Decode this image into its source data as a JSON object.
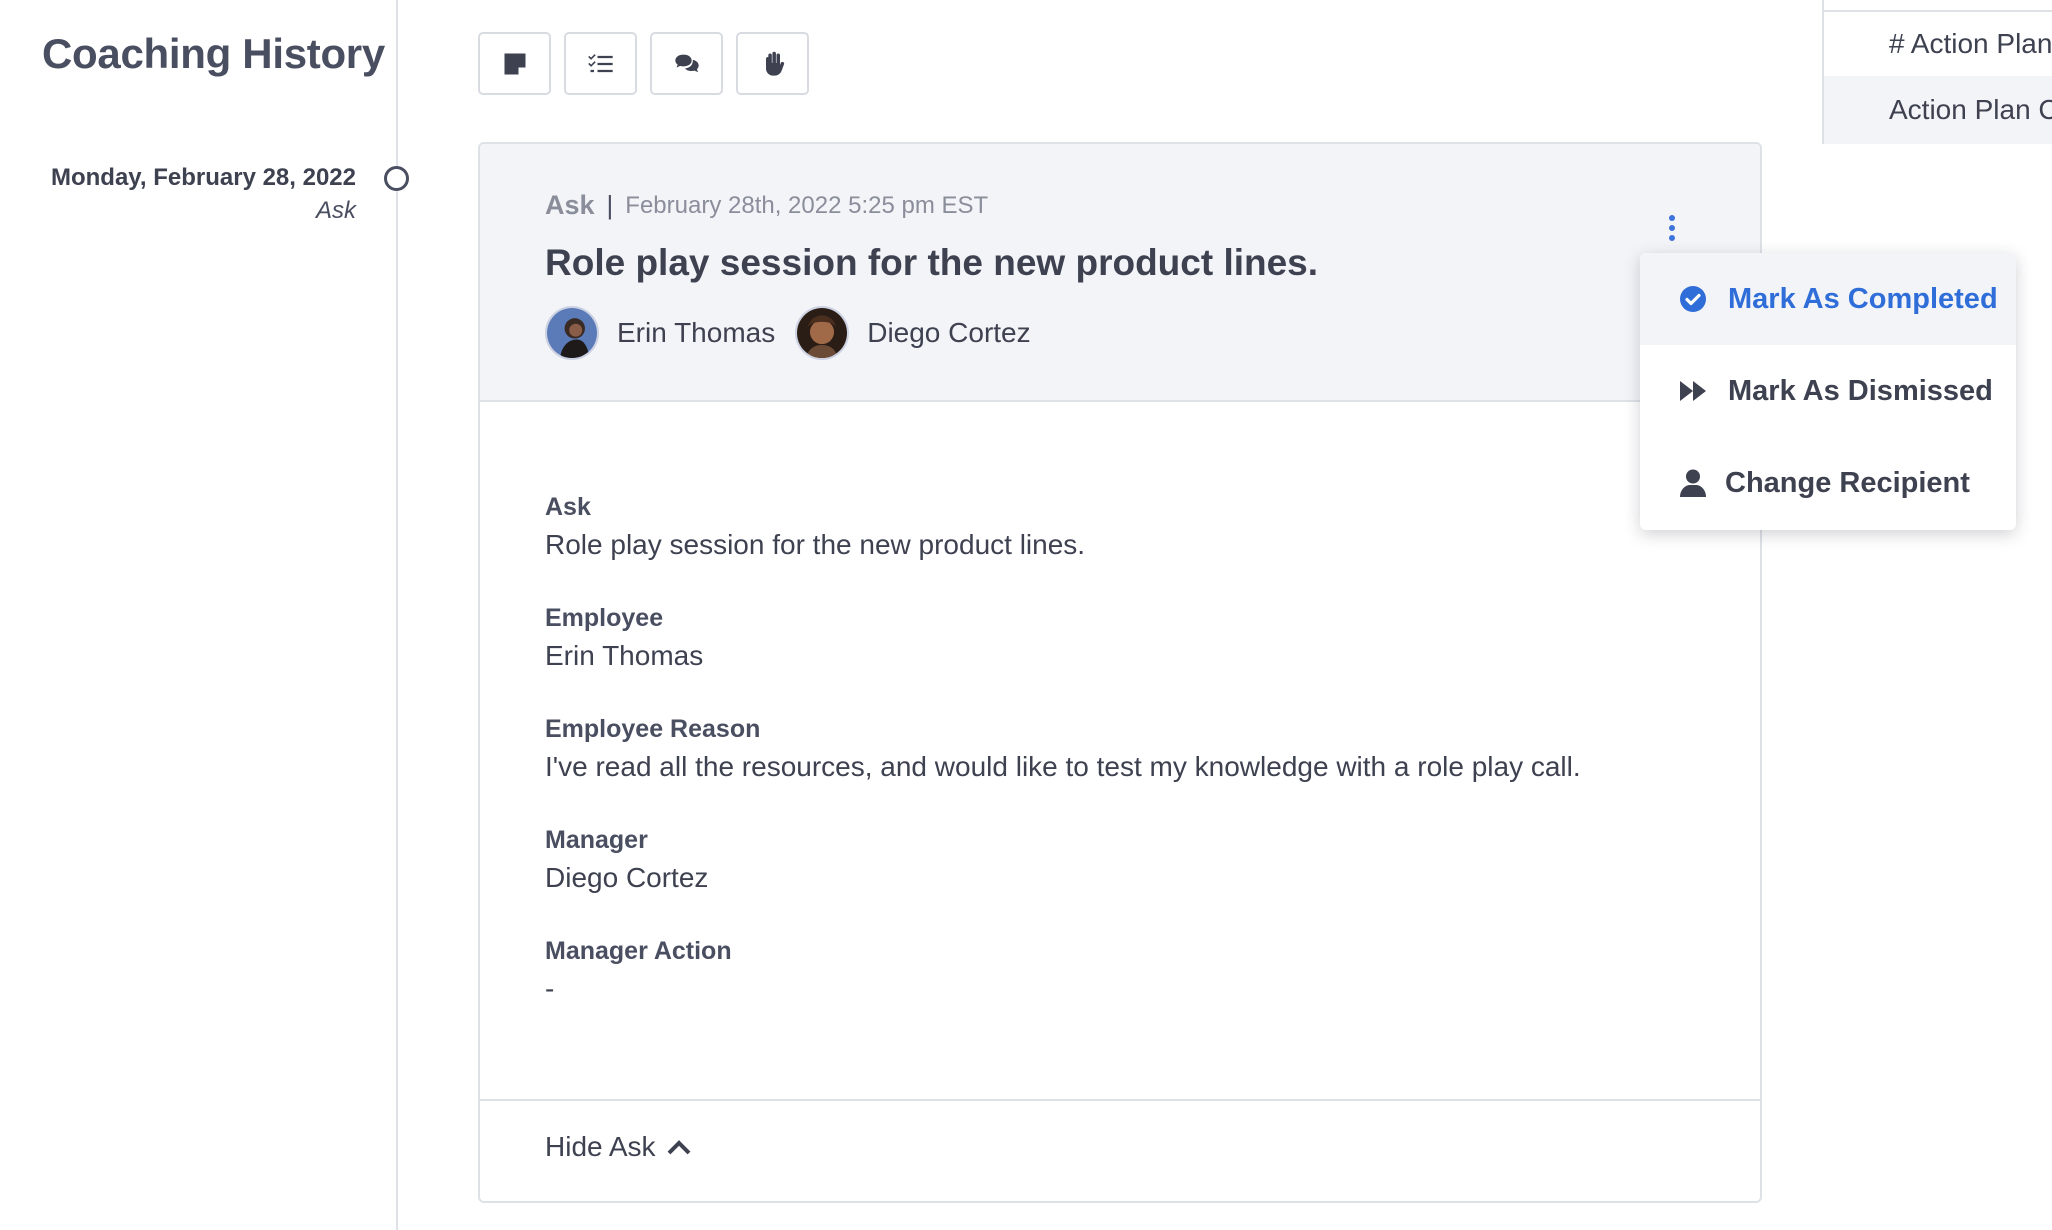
{
  "sidebar": {
    "title": "Coaching History",
    "entry": {
      "date": "Monday, February 28, 2022",
      "type": "Ask"
    }
  },
  "toolbar": {
    "buttons": [
      {
        "icon": "note-icon"
      },
      {
        "icon": "checklist-icon"
      },
      {
        "icon": "comments-icon"
      },
      {
        "icon": "raised-hand-icon"
      }
    ]
  },
  "card": {
    "type": "Ask",
    "separator": "|",
    "timestamp": "February 28th, 2022 5:25 pm EST",
    "title": "Role play session for the new product lines.",
    "people": [
      {
        "name": "Erin Thomas"
      },
      {
        "name": "Diego Cortez"
      }
    ],
    "fields": [
      {
        "label": "Ask",
        "value": "Role play session for the new product lines."
      },
      {
        "label": "Employee",
        "value": "Erin Thomas"
      },
      {
        "label": "Employee Reason",
        "value": "I've read all the resources, and would like to test my knowledge with a role play call."
      },
      {
        "label": "Manager",
        "value": "Diego Cortez"
      },
      {
        "label": "Manager Action",
        "value": "-"
      }
    ],
    "footer": {
      "hide_label": "Hide Ask"
    }
  },
  "menu": {
    "items": [
      {
        "label": "Mark As Completed",
        "icon": "check-circle-icon",
        "color": "#2f6ed8"
      },
      {
        "label": "Mark As Dismissed",
        "icon": "fast-forward-icon"
      },
      {
        "label": "Change Recipient",
        "icon": "user-icon"
      }
    ]
  },
  "right_panel": {
    "rows": [
      "# Action Plans",
      "Action Plan C"
    ]
  },
  "colors": {
    "accent": "#2f6ed8",
    "text": "#3d4150",
    "muted": "#8a8e9b",
    "header_bg": "#f3f4f8",
    "border": "#dfe1e8"
  }
}
